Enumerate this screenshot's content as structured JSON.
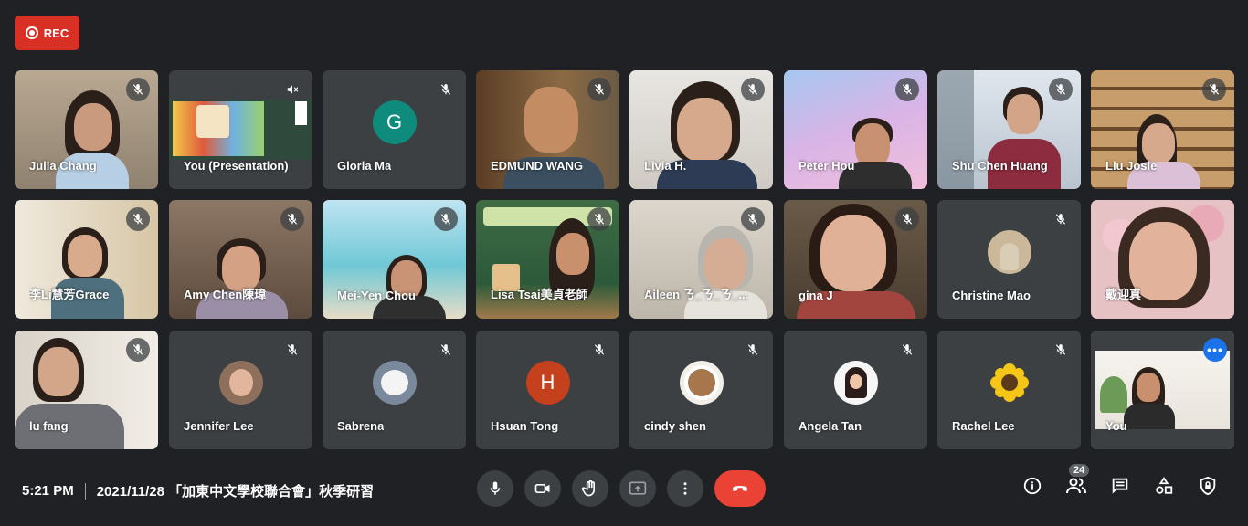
{
  "rec": {
    "label": "REC"
  },
  "participants": [
    {
      "name": "Julia Chang",
      "type": "video",
      "muted": true
    },
    {
      "name": "You (Presentation)",
      "type": "presentation",
      "muted": true
    },
    {
      "name": "Gloria Ma",
      "type": "avatar",
      "initial": "G",
      "avatar_color": "#0f8b7e",
      "muted": true
    },
    {
      "name": "EDMUND WANG",
      "type": "video",
      "muted": true
    },
    {
      "name": "Livia H.",
      "type": "video",
      "muted": true
    },
    {
      "name": "Peter Hou",
      "type": "video",
      "muted": true
    },
    {
      "name": "Shu Chen Huang",
      "type": "video",
      "muted": true
    },
    {
      "name": "Liu Josie",
      "type": "video",
      "muted": true
    },
    {
      "name": "李Li慧芳Grace",
      "type": "video",
      "muted": true
    },
    {
      "name": "Amy Chen陳瑋",
      "type": "video",
      "muted": true
    },
    {
      "name": "Mei-Yen Chou",
      "type": "video",
      "muted": true
    },
    {
      "name": "Lisa Tsai美貞老師",
      "type": "video",
      "muted": true
    },
    {
      "name": "Aileen ㄋ_ㄋ_ㄋ_...",
      "type": "video",
      "muted": true
    },
    {
      "name": "gina J",
      "type": "video",
      "muted": true
    },
    {
      "name": "Christine Mao",
      "type": "avatar-photo",
      "muted": true
    },
    {
      "name": "戴迎真",
      "type": "video",
      "muted": false
    },
    {
      "name": "lu fang",
      "type": "video",
      "muted": true
    },
    {
      "name": "Jennifer Lee",
      "type": "avatar-photo",
      "muted": true
    },
    {
      "name": "Sabrena",
      "type": "avatar-photo",
      "muted": true
    },
    {
      "name": "Hsuan Tong",
      "type": "avatar",
      "initial": "H",
      "avatar_color": "#c5411e",
      "muted": true
    },
    {
      "name": "cindy shen",
      "type": "avatar-photo",
      "muted": true
    },
    {
      "name": "Angela Tan",
      "type": "avatar-photo",
      "muted": true
    },
    {
      "name": "Rachel Lee",
      "type": "avatar-photo",
      "muted": true
    },
    {
      "name": "You",
      "type": "video",
      "muted": false,
      "selected": true
    }
  ],
  "footer": {
    "time": "5:21 PM",
    "meeting_title": "2021/11/28 「加東中文學校聯合會」秋季研習",
    "participant_count": "24"
  },
  "colors": {
    "background": "#202124",
    "tile": "#3c4043",
    "end_call": "#ea4335",
    "rec": "#d93025",
    "accent": "#1a73e8"
  }
}
